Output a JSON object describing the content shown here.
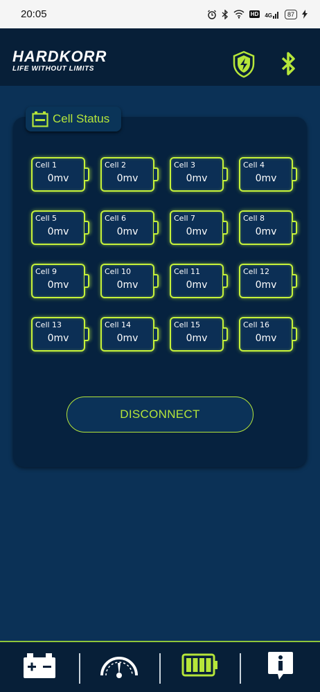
{
  "status_bar": {
    "time": "20:05",
    "icons": [
      "alarm-icon",
      "bluetooth-icon",
      "wifi-icon",
      "hd-badge",
      "signal-4g-icon",
      "battery-icon",
      "charging-icon"
    ],
    "hd_label": "HD",
    "network_label": "4G",
    "battery_level": "87"
  },
  "header": {
    "brand": "HARDKORR",
    "tagline": "LIFE WITHOUT LIMITS",
    "icons": [
      "shield-lightning-icon",
      "bluetooth-icon"
    ],
    "accent_color": "#b6e63a"
  },
  "panel": {
    "title": "Cell Status",
    "title_icon": "battery-cell-icon",
    "cells": [
      {
        "label": "Cell  1",
        "value": "0mv"
      },
      {
        "label": "Cell  2",
        "value": "0mv"
      },
      {
        "label": "Cell  3",
        "value": "0mv"
      },
      {
        "label": "Cell  4",
        "value": "0mv"
      },
      {
        "label": "Cell  5",
        "value": "0mv"
      },
      {
        "label": "Cell  6",
        "value": "0mv"
      },
      {
        "label": "Cell  7",
        "value": "0mv"
      },
      {
        "label": "Cell  8",
        "value": "0mv"
      },
      {
        "label": "Cell  9",
        "value": "0mv"
      },
      {
        "label": "Cell  10",
        "value": "0mv"
      },
      {
        "label": "Cell  11",
        "value": "0mv"
      },
      {
        "label": "Cell  12",
        "value": "0mv"
      },
      {
        "label": "Cell  13",
        "value": "0mv"
      },
      {
        "label": "Cell  14",
        "value": "0mv"
      },
      {
        "label": "Cell  15",
        "value": "0mv"
      },
      {
        "label": "Cell  16",
        "value": "0mv"
      }
    ],
    "disconnect_label": "DISCONNECT"
  },
  "bottom_nav": {
    "items": [
      "car-battery-icon",
      "gauge-icon",
      "battery-full-icon",
      "info-icon"
    ],
    "active_color": "#b6e63a"
  }
}
